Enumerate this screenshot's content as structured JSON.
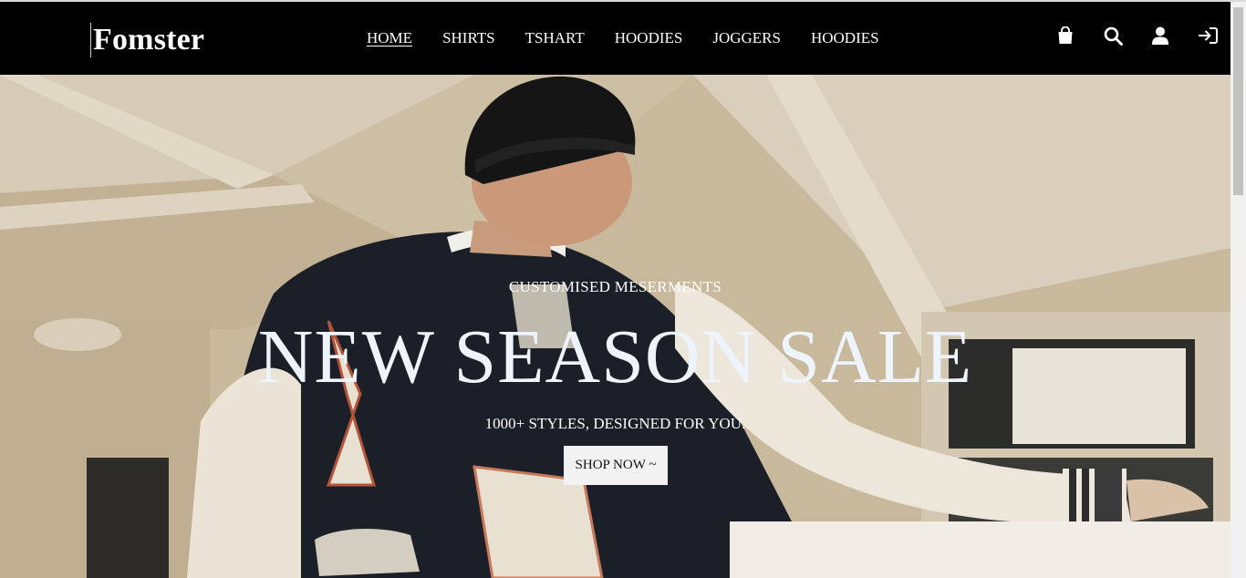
{
  "brand": {
    "name": "Fomster"
  },
  "nav": {
    "links": [
      {
        "label": "HOME",
        "active": true
      },
      {
        "label": "SHIRTS",
        "active": false
      },
      {
        "label": "TSHART",
        "active": false
      },
      {
        "label": "HOODIES",
        "active": false
      },
      {
        "label": "JOGGERS",
        "active": false
      },
      {
        "label": "HOODIES",
        "active": false
      }
    ],
    "icons": [
      "shopping-bag-icon",
      "search-icon",
      "user-icon",
      "login-icon"
    ]
  },
  "hero": {
    "subtitle": "CUSTOMISED MESERMENTS",
    "title": "NEW SEASON SALE",
    "tagline": "1000+ STYLES, DESIGNED FOR YOU.",
    "cta_label": "SHOP NOW ~",
    "background_image": "man-in-varsity-jacket-photo"
  },
  "colors": {
    "navbar_bg": "#000000",
    "nav_text": "#ffffff",
    "hero_title": "#eef4fb",
    "cta_bg": "#f2f2f2"
  }
}
